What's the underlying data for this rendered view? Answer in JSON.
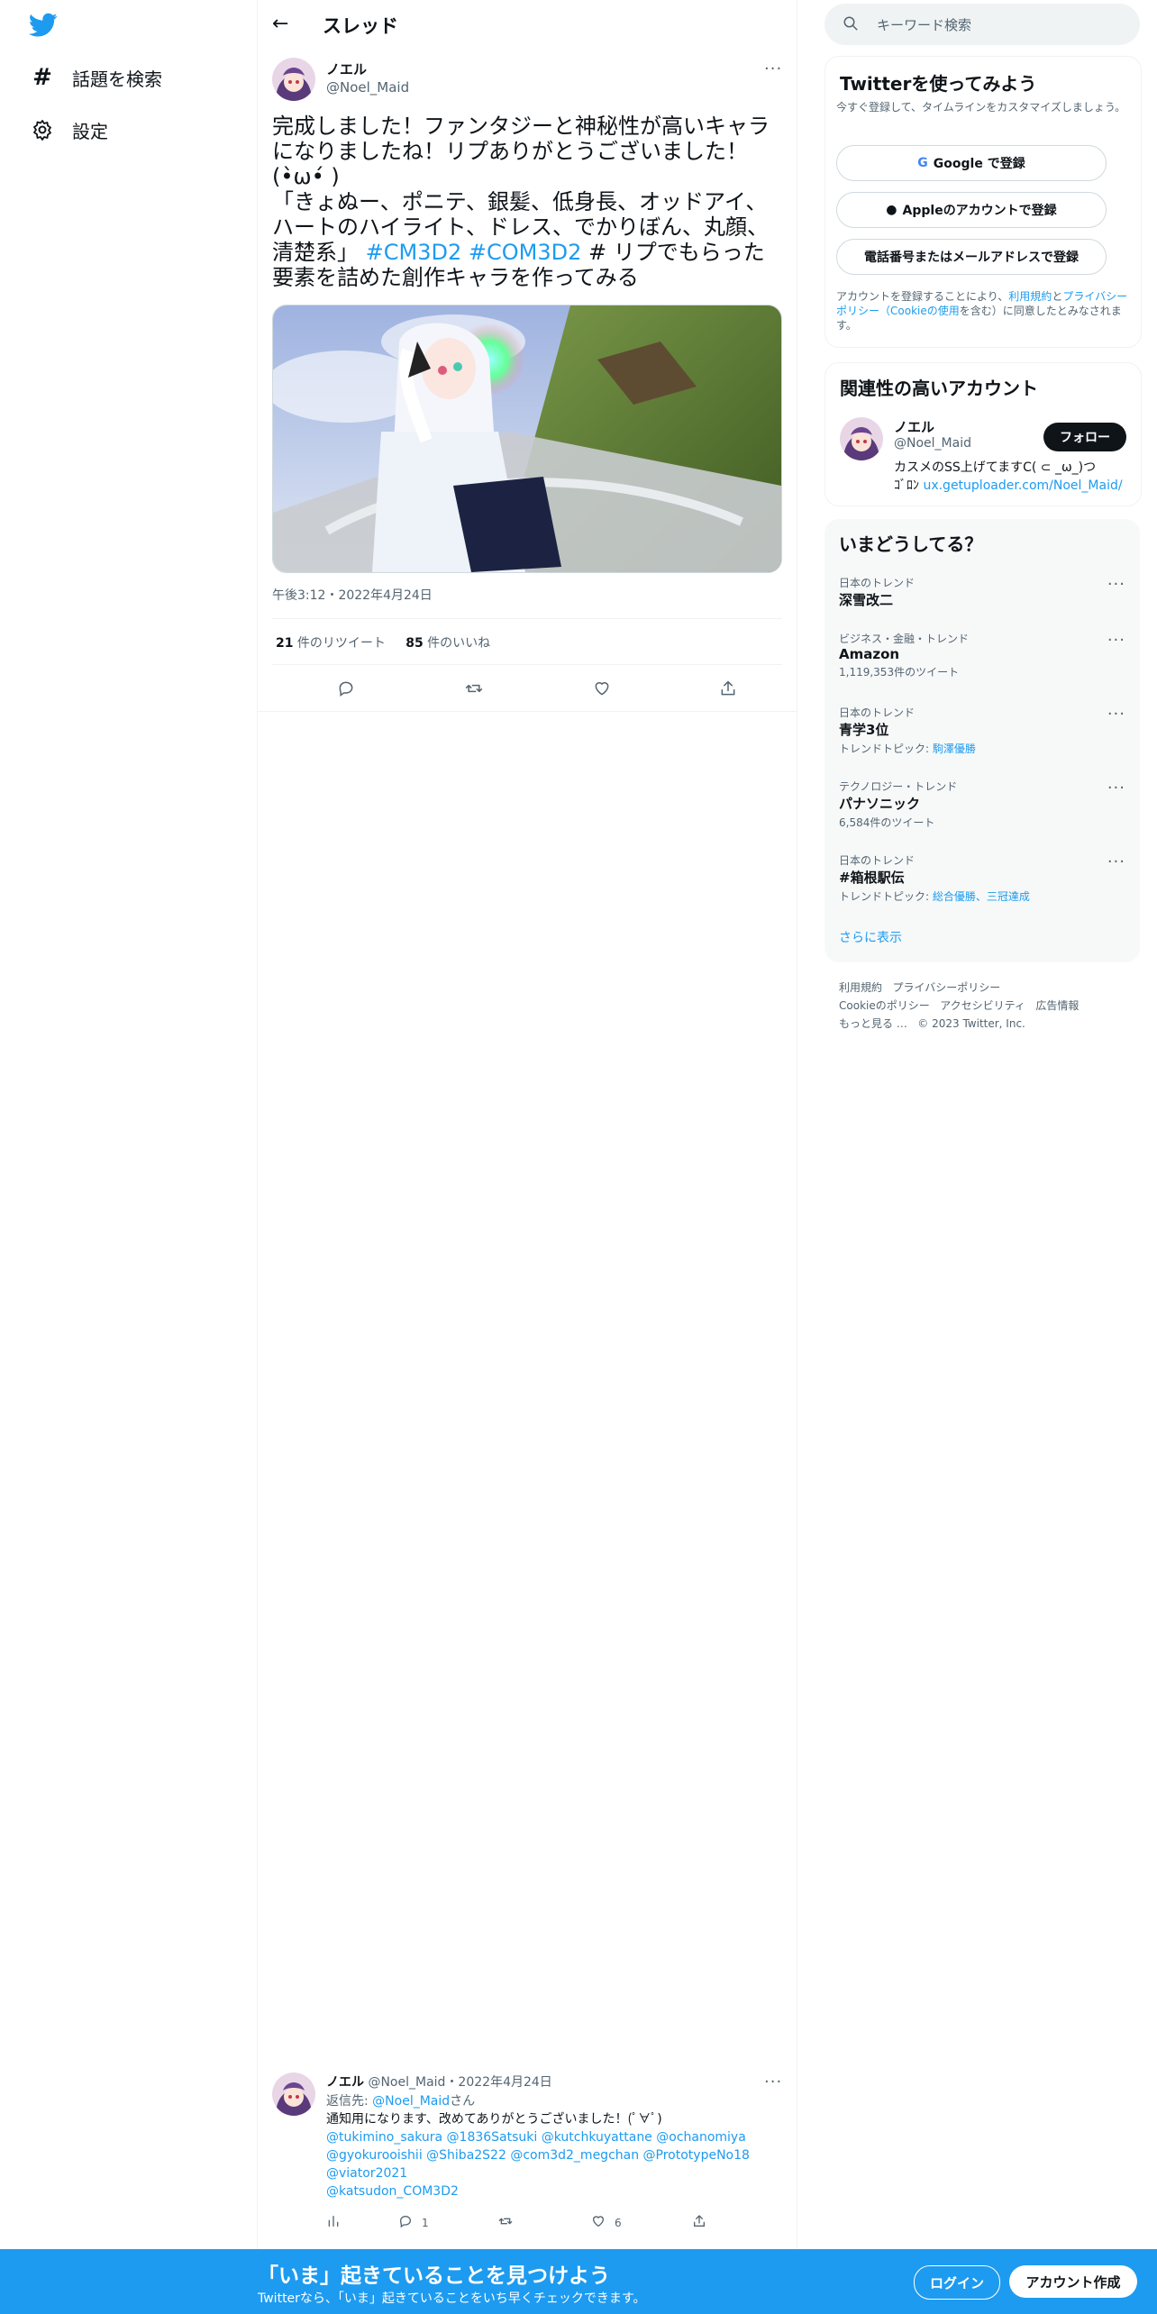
{
  "nav": {
    "items": [
      {
        "label": "話題を検索",
        "icon": "hashtag-icon"
      },
      {
        "label": "設定",
        "icon": "gear-icon"
      }
    ]
  },
  "header": {
    "title": "スレッド"
  },
  "tweet": {
    "name": "ノエル",
    "handle": "@Noel_Maid",
    "text_1": "完成しました！ファンタジーと神秘性が高いキャラになりましたね！リプありがとうございました！(•̀ω•́ )\n「きょぬー、ポニテ、銀髪、低身長、オッドアイ、ハートのハイライト、ドレス、でかりぼん、丸顔、清楚系」 ",
    "tag_1": "#CM3D2",
    "tag_2": "#COM3D2",
    "text_2": " # リプでもらった要素を詰めた創作キャラを作ってみる",
    "timestamp": "午後3:12・2022年4月24日",
    "retweets_count": "21",
    "retweets_label": " 件のリツイート",
    "likes_count": "85",
    "likes_label": " 件のいいね"
  },
  "reply": {
    "name": "ノエル",
    "handle": "@Noel_Maid",
    "date": "・2022年4月24日",
    "reply_to_prefix": "返信先: ",
    "reply_to_handle": "@Noel_Maid",
    "reply_to_suffix": "さん",
    "text": "通知用になります、改めてありがとうございました！(ﾟ∀ﾟ)",
    "mentions_1": "@tukimino_sakura @1836Satsuki @kutchkuyattane @ochanomiya",
    "mentions_2": "@gyokurooishii @Shiba2S22 @com3d2_megchan @PrototypeNo18",
    "mentions_3": "@viator2021",
    "mentions_4": "@katsudon_COM3D2",
    "reply_count": "1",
    "like_count": "6"
  },
  "search": {
    "placeholder": "キーワード検索"
  },
  "signup_panel": {
    "title": "Twitterを使ってみよう",
    "subtitle": "今すぐ登録して、タイムラインをカスタマイズしましょう。",
    "google": "Google で登録",
    "apple": "Appleのアカウントで登録",
    "phone": "電話番号またはメールアドレスで登録",
    "terms_1": "アカウントを登録することにより、",
    "terms_link_1": "利用規約",
    "terms_2": "と",
    "terms_link_2": "プライバシーポリシー（Cookieの使用",
    "terms_3": "を含む）に同意したとみなされます。"
  },
  "related": {
    "title": "関連性の高いアカウント",
    "name": "ノエル",
    "handle": "@Noel_Maid",
    "follow": "フォロー",
    "bio_1": "カスメのSS上げてますC( ⊂ _ω_)つ",
    "bio_2": "ｺﾞﾛﾝ ",
    "bio_link": "ux.getuploader.com/Noel_Maid/"
  },
  "trends": {
    "title": "いまどうしてる？",
    "items": [
      {
        "category": "日本のトレンド",
        "name": "深雪改二",
        "extra": "",
        "link": ""
      },
      {
        "category": "ビジネス・金融・トレンド",
        "name": "Amazon",
        "extra": "1,119,353件のツイート",
        "link": ""
      },
      {
        "category": "日本のトレンド",
        "name": "青学3位",
        "extra": "トレンドトピック: ",
        "link": "駒澤優勝"
      },
      {
        "category": "テクノロジー・トレンド",
        "name": "パナソニック",
        "extra": "6,584件のツイート",
        "link": ""
      },
      {
        "category": "日本のトレンド",
        "name": "#箱根駅伝",
        "extra": "トレンドトピック: ",
        "link": "総合優勝、三冠達成"
      }
    ],
    "more": "さらに表示"
  },
  "footer": {
    "l1a": "利用規約",
    "l1b": "プライバシーポリシー",
    "l2a": "Cookieのポリシー",
    "l2b": "アクセシビリティ",
    "l2c": "広告情報",
    "l3a": "もっと見る …",
    "l3b": "© 2023 Twitter, Inc."
  },
  "bottom_bar": {
    "title": "「いま」起きていることを見つけよう",
    "subtitle": "Twitterなら、「いま」起きていることをいち早くチェックできます。",
    "login": "ログイン",
    "signup": "アカウント作成"
  },
  "colors": {
    "accent": "#1d9bf0",
    "text": "#0f1419",
    "muted": "#536471",
    "border": "#eff3f4"
  }
}
